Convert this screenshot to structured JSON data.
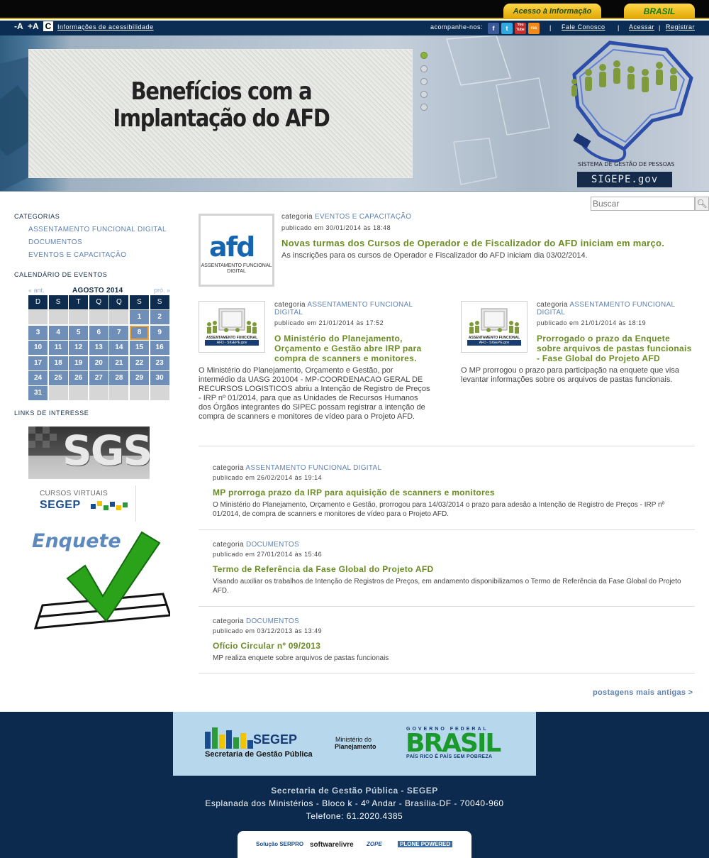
{
  "topbar": {
    "acesso": "Acesso à Informação",
    "brasil": "BRASIL"
  },
  "util": {
    "font_minus": "-A",
    "font_plus": "+A",
    "contrast": "C",
    "accessibility": "Informações de acessibilidade",
    "follow": "acompanhe-nos:",
    "social": {
      "facebook": "f",
      "twitter": "t",
      "youtube": "You Tube",
      "rss": "rss"
    },
    "sep": "|",
    "contact": "Fale Conosco",
    "login": "Acessar",
    "register": "Registrar"
  },
  "banner": {
    "slide_title_1": "Benefícios com a",
    "slide_title_2": "Implantação do AFD",
    "logo_sub": "SISTEMA DE GESTÃO DE PESSOAS",
    "logo_name": "SIGEPE.gov"
  },
  "search": {
    "placeholder": "Buscar"
  },
  "sidebar": {
    "categories_title": "CATEGORIAS",
    "categories": [
      "ASSENTAMENTO FUNCIONAL DIGITAL",
      "DOCUMENTOS",
      "EVENTOS E CAPACITAÇÃO"
    ],
    "calendar_title": "CALENDÁRIO DE EVENTOS",
    "calendar": {
      "prev": "« ant.",
      "month": "AGOSTO 2014",
      "next": "pró. »",
      "weekdays": [
        "D",
        "S",
        "T",
        "Q",
        "Q",
        "S",
        "S"
      ],
      "first_weekday": 5,
      "days_in_month": 31,
      "today": 8
    },
    "links_title": "LINKS DE INTERESSE",
    "link_sgs": "SGS",
    "link_cv_top": "CURSOS VIRTUAIS",
    "link_cv_main": "SEGEP",
    "link_enquete": "Enquete"
  },
  "labels": {
    "categoria": "categoria"
  },
  "featured": {
    "category": "EVENTOS E CAPACITAÇÃO",
    "published": "publicado em 30/01/2014 às 18:48",
    "title": "Novas turmas dos Cursos de Operador e de Fiscalizador do AFD iniciam em março.",
    "summary": "As inscrições para os cursos de Operador e Fiscalizador do AFD iniciam dia 03/02/2014.",
    "thumb_word": "afd",
    "thumb_caption": "ASSENTAMENTO FUNCIONAL DIGITAL"
  },
  "thumb_small": {
    "caption": "ASSENTAMENTO FUNCIONAL DIGITAL",
    "bar": "AFD - SIGEPE.gov"
  },
  "col_posts": [
    {
      "category": "ASSENTAMENTO FUNCIONAL DIGITAL",
      "published": "publicado em 21/01/2014 às 17:52",
      "title": "O Ministério do Planejamento, Orçamento e Gestão abre IRP para compra de scanners e monitores.",
      "summary": "O Ministério do Planejamento, Orçamento e Gestão, por intermédio da UASG 201004 - MP-COORDENACAO GERAL DE RECURSOS LOGISTICOS abriu a Intenção de Registro de Preços - IRP nº 01/2014, para que as Unidades de Recursos Humanos dos Órgãos integrantes do SIPEC possam registrar a intenção de compra de scanners e monitores de vídeo para o Projeto AFD."
    },
    {
      "category": "ASSENTAMENTO FUNCIONAL DIGITAL",
      "published": "publicado em 21/01/2014 às 18:19",
      "title": "Prorrogado o prazo da Enquete sobre arquivos de pastas funcionais - Fase Global do Projeto AFD",
      "summary": "O MP prorrogou o prazo para participação na enquete que visa levantar informações sobre os arquivos de pastas funcionais."
    }
  ],
  "list_posts": [
    {
      "category": "ASSENTAMENTO FUNCIONAL DIGITAL",
      "published": "publicado em 26/02/2014 às 19:14",
      "title": "MP prorroga prazo da IRP para aquisição de scanners e monitores",
      "summary": "O Ministério do Planejamento, Orçamento e Gestão, prorrogou para 14/03/2014 o prazo para adesão a Intenção de Registro de Preços - IRP nº 01/2014, de compra de scanners e monitores de vídeo para o Projeto AFD."
    },
    {
      "category": "DOCUMENTOS",
      "published": "publicado em 27/01/2014 às 15:46",
      "title": "Termo de Referência da Fase Global do Projeto AFD",
      "summary": "Visando auxiliar os trabalhos de Intenção de Registros de Preços, em andamento disponibilizamos o Termo de Referência da Fase Global do Projeto AFD."
    },
    {
      "category": "DOCUMENTOS",
      "published": "publicado em 03/12/2013 às 13:49",
      "title": "Ofício Circular nº 09/2013",
      "summary": "MP realiza enquete sobre arquivos de pastas funcionais"
    }
  ],
  "older": "postagens mais antigas >",
  "footer": {
    "segep": "SEGEP",
    "segep_sub": "Secretaria de Gestão Pública",
    "ministerio_1": "Ministério do",
    "ministerio_2": "Planejamento",
    "gov_federal": "GOVERNO FEDERAL",
    "brasil": "BRASIL",
    "brasil_sub": "PAÍS RICO É PAÍS SEM POBREZA",
    "line1": "Secretaria de Gestão Pública - SEGEP",
    "line2": "Esplanada dos Ministérios - Bloco k - 4º Andar - Brasília-DF - 70040-960",
    "line3": "Telefone: 61.2020.4385",
    "powered": [
      "Solução SERPRO",
      "softwarelivre",
      "ZOPE",
      "PLONE POWERED"
    ]
  }
}
